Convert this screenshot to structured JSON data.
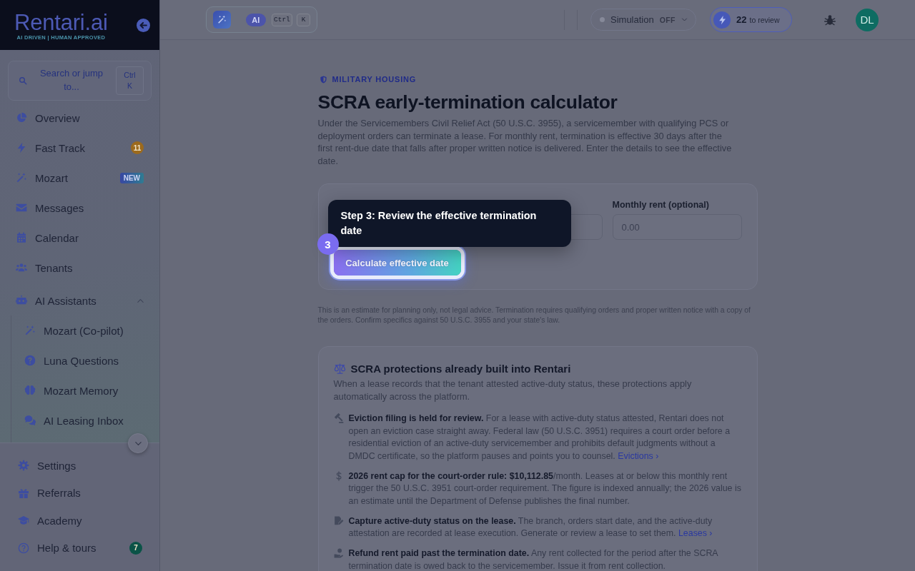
{
  "sidebar": {
    "logo": {
      "name": "Rentari.ai",
      "tagline": "AI DRIVEN | HUMAN APPROVED"
    },
    "search": {
      "placeholder": "Search or jump to...",
      "shortcut": "Ctrl K"
    },
    "items": [
      {
        "label": "Overview",
        "selected": false
      },
      {
        "label": "Fast Track",
        "selected": false,
        "badge": {
          "kind": "count",
          "text": "11",
          "color": "#9c6a1d"
        }
      },
      {
        "label": "Mozart",
        "selected": false,
        "badge": {
          "kind": "new",
          "text": "NEW"
        }
      },
      {
        "label": "Messages",
        "selected": false
      },
      {
        "label": "Calendar",
        "selected": false
      },
      {
        "label": "Tenants",
        "selected": false
      },
      {
        "label": "AI Assistants",
        "selected": false,
        "expanded": true,
        "children": [
          {
            "label": "Mozart (Co-pilot)",
            "selected": false
          },
          {
            "label": "Luna Questions",
            "selected": false
          },
          {
            "label": "Mozart Memory",
            "selected": false
          },
          {
            "label": "AI Leasing Inbox",
            "selected": false
          }
        ]
      }
    ],
    "footer_items": [
      {
        "label": "Settings",
        "selected": false
      },
      {
        "label": "Referrals",
        "selected": false
      },
      {
        "label": "Academy",
        "selected": false
      },
      {
        "label": "Help & tours",
        "selected": false,
        "badge": {
          "kind": "count",
          "text": "7",
          "color": "#0b5347"
        }
      }
    ]
  },
  "topbar": {
    "ai_command": {
      "badge": "AI",
      "keys": [
        "Ctrl",
        "K"
      ]
    },
    "simulation": {
      "label": "Simulation",
      "state": "OFF",
      "on": false
    },
    "review": {
      "count": "22",
      "label": "to review"
    },
    "avatar": {
      "initials": "DL"
    }
  },
  "page": {
    "eyebrow": "MILITARY HOUSING",
    "title": "SCRA early-termination calculator",
    "intro": "Under the Servicemembers Civil Relief Act (50 U.S.C. 3955), a servicemember with qualifying PCS or deployment orders can terminate a lease. For monthly rent, termination is effective 30 days after the first rent-due date that falls after proper written notice is delivered. Enter the details to see the effective date.",
    "form": {
      "fields": [
        {
          "kind": "input"
        },
        {
          "kind": "input",
          "label": "Monthly rent (optional)",
          "placeholder": "0.00"
        }
      ],
      "button": {
        "label": "Calculate effective date",
        "highlighted": true
      }
    },
    "tour_step": {
      "number": "3",
      "text": "Step 3: Review the effective termination date"
    },
    "disclaimer": "This is an estimate for planning only, not legal advice. Termination requires qualifying orders and proper written notice with a copy of the orders. Confirm specifics against 50 U.S.C. 3955 and your state's law.",
    "protections": {
      "title": "SCRA protections already built into Rentari",
      "intro": "When a lease records that the tenant attested active-duty status, these protections apply automatically across the platform.",
      "items": [
        {
          "text": "**Eviction filing is held for review.** For a lease with active-duty status attested, Rentari does not open an eviction case straight away. Federal law (50 U.S.C. 3951) requires a court order before a residential eviction of an active-duty servicemember and prohibits default judgments without a DMDC certificate, so the platform pauses and points you to counsel.",
          "link": "Evictions ›"
        },
        {
          "text": "**2026 rent cap for the court-order rule: $10,112.85**/month. Leases at or below this monthly rent trigger the 50 U.S.C. 3951 court-order requirement. The figure is indexed annually; the 2026 value is an estimate until the Department of Defense publishes the final number."
        },
        {
          "text": "**Capture active-duty status on the lease.** The branch, orders start date, and the active-duty attestation are recorded at lease execution. Generate or review a lease to set them.",
          "link": "Leases ›"
        },
        {
          "text": "**Refund rent paid past the termination date.** Any rent collected for the period after the SCRA termination date is owed back to the servicemember. Issue it from rent collection."
        }
      ]
    }
  }
}
